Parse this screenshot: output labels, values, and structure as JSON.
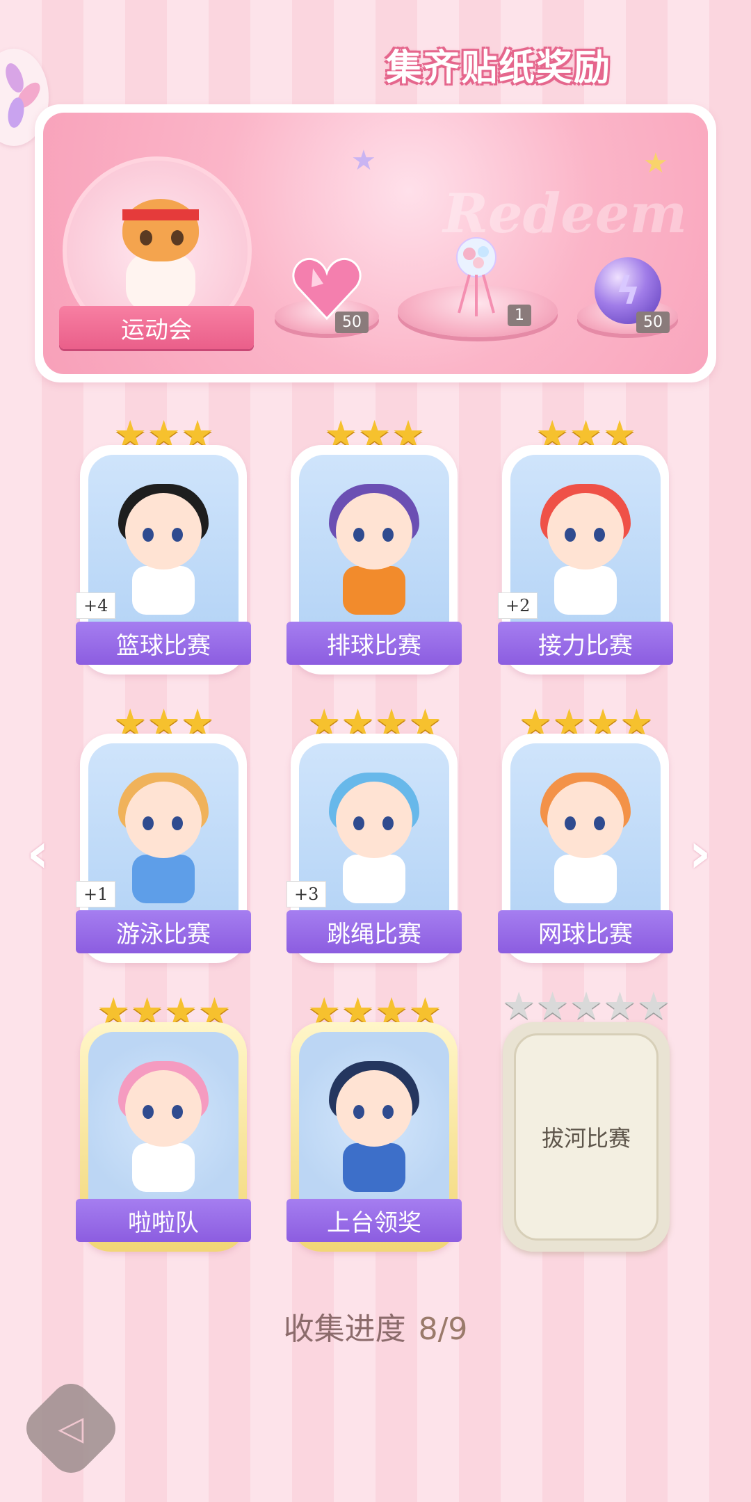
{
  "banner": {
    "title": "集齐贴纸奖励",
    "watermark": "Redeem",
    "event_label": "运动会",
    "rewards": [
      {
        "icon": "pink-heart-gem-icon",
        "qty": "50"
      },
      {
        "icon": "flower-bouquet-icon",
        "qty": "1"
      },
      {
        "icon": "purple-energy-orb-icon",
        "qty": "50"
      }
    ]
  },
  "cards": [
    {
      "name": "篮球比赛",
      "stars": 3,
      "bonus": "+4",
      "hair": "#1e1e1e",
      "shirt": "#ffffff"
    },
    {
      "name": "排球比赛",
      "stars": 3,
      "bonus": "",
      "hair": "#6b4fb3",
      "shirt": "#f28b2c"
    },
    {
      "name": "接力比赛",
      "stars": 3,
      "bonus": "+2",
      "hair": "#ef5147",
      "shirt": "#ffffff"
    },
    {
      "name": "游泳比赛",
      "stars": 3,
      "bonus": "+1",
      "hair": "#f0b25a",
      "shirt": "#5e9ee8"
    },
    {
      "name": "跳绳比赛",
      "stars": 4,
      "bonus": "+3",
      "hair": "#67b8ea",
      "shirt": "#ffffff"
    },
    {
      "name": "网球比赛",
      "stars": 4,
      "bonus": "",
      "hair": "#f39248",
      "shirt": "#ffffff"
    },
    {
      "name": "啦啦队",
      "stars": 4,
      "bonus": "",
      "hair": "#f59bc0",
      "shirt": "#ffffff"
    },
    {
      "name": "上台领奖",
      "stars": 4,
      "bonus": "",
      "hair": "#24365f",
      "shirt": "#3d6fc9"
    }
  ],
  "locked_card": {
    "name": "拔河比赛",
    "stars": 5
  },
  "progress": {
    "label": "收集进度",
    "value": "8/9"
  },
  "nav": {
    "prev": "‹",
    "next": "›"
  },
  "colors": {
    "accent": "#f07fa3",
    "label_purple": "#9166e6",
    "star_gold": "#f6c12e"
  }
}
